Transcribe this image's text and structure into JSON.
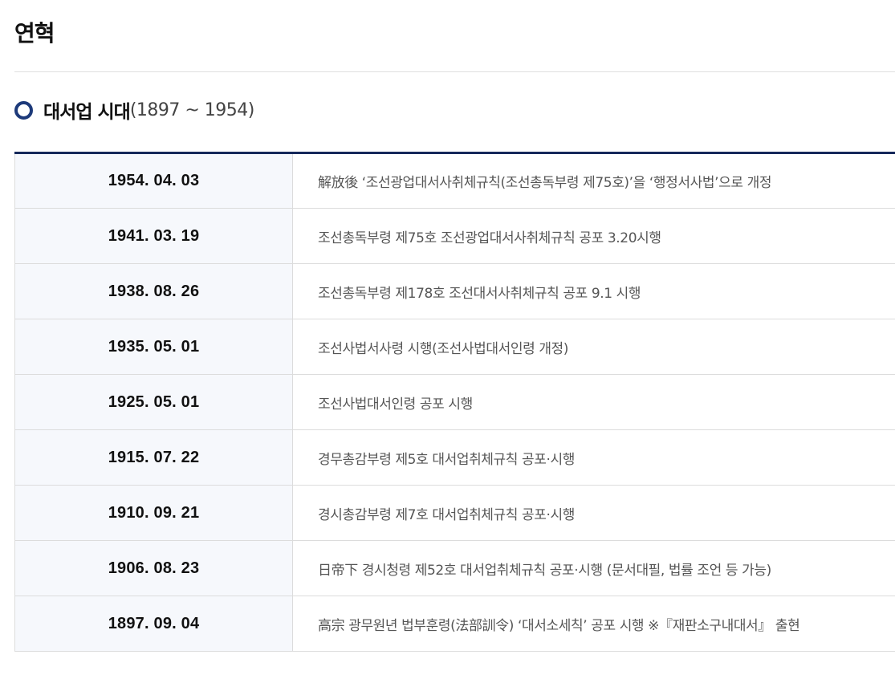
{
  "page": {
    "title": "연혁"
  },
  "section": {
    "title": "대서업 시대",
    "period": "(1897 ~ 1954)"
  },
  "colors": {
    "accent_navy": "#15285a",
    "bullet_ring": "#1d3a7a",
    "date_cell_bg": "#f6f8fc"
  },
  "icons": {
    "bullet": "circle-bullet-icon"
  },
  "timeline": {
    "rows": [
      {
        "date": "1954. 04. 03",
        "event": "解放後 ‘조선광업대서사취체규칙(조선총독부령 제75호)’을 ‘행정서사법’으로 개정"
      },
      {
        "date": "1941. 03. 19",
        "event": "조선총독부령 제75호 조선광업대서사취체규칙 공포 3.20시행"
      },
      {
        "date": "1938. 08. 26",
        "event": "조선총독부령 제178호 조선대서사취체규칙 공포 9.1 시행"
      },
      {
        "date": "1935. 05. 01",
        "event": "조선사법서사령 시행(조선사법대서인령 개정)"
      },
      {
        "date": "1925. 05. 01",
        "event": "조선사법대서인령 공포 시행"
      },
      {
        "date": "1915. 07. 22",
        "event": "경무총감부령 제5호 대서업취체규칙 공포·시행"
      },
      {
        "date": "1910. 09. 21",
        "event": "경시총감부령 제7호 대서업취체규칙 공포·시행"
      },
      {
        "date": "1906. 08. 23",
        "event": "日帝下 경시청령 제52호 대서업취체규칙 공포·시행 (문서대필, 법률 조언 등 가능)"
      },
      {
        "date": "1897. 09. 04",
        "event": "高宗 광무원년 법부훈령(法部訓令) ‘대서소세칙’ 공포 시행 ※『재판소구내대서』 출현"
      }
    ]
  }
}
